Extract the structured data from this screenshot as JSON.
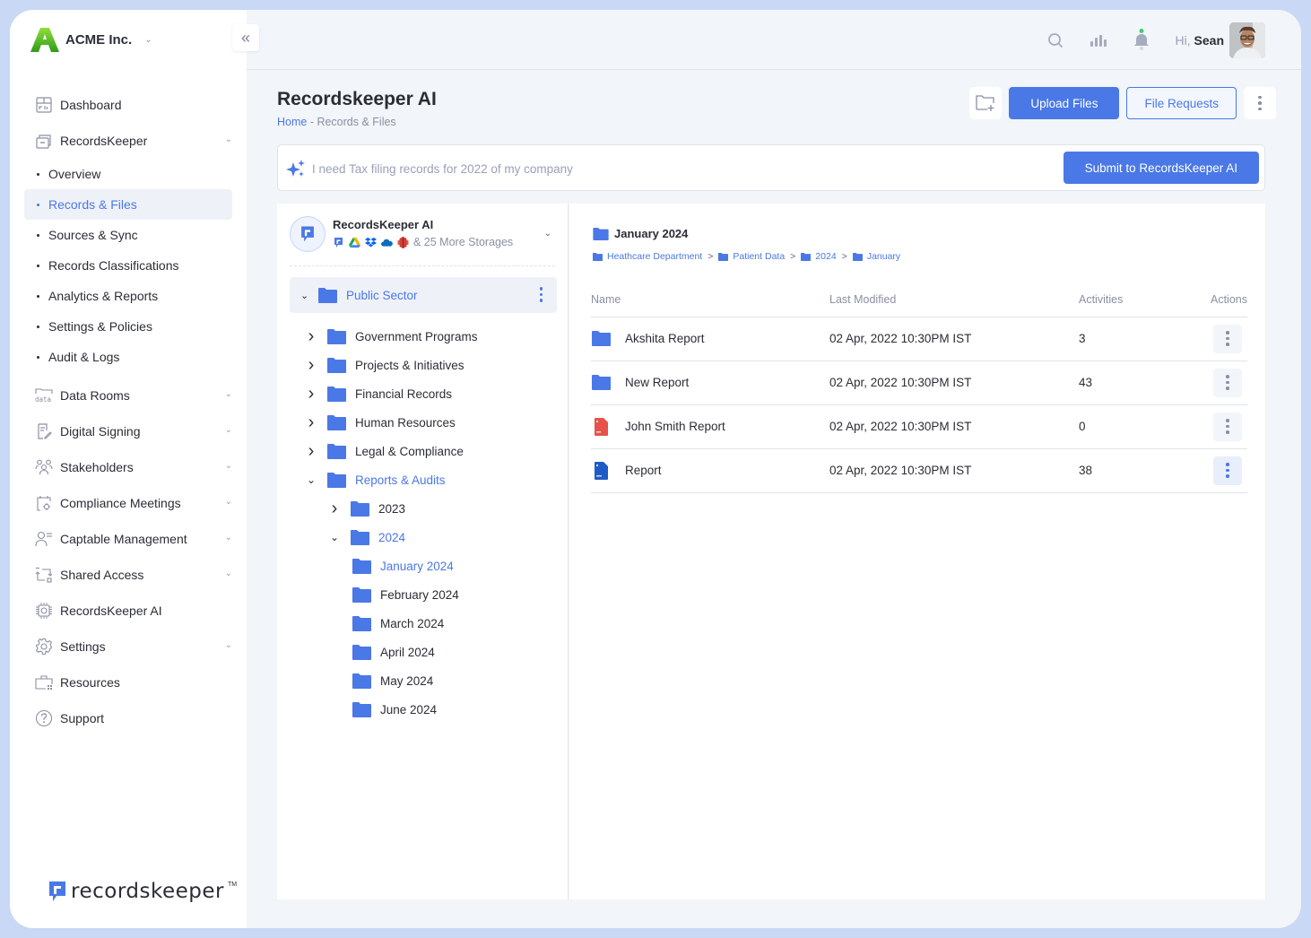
{
  "brand": {
    "company": "ACME Inc."
  },
  "sidebar": {
    "items": [
      {
        "label": "Dashboard",
        "icon": "dashboard-icon",
        "expandable": false
      },
      {
        "label": "RecordsKeeper",
        "icon": "archive-box-icon",
        "expandable": true,
        "children": [
          {
            "label": "Overview",
            "active": false
          },
          {
            "label": "Records & Files",
            "active": true
          },
          {
            "label": "Sources & Sync",
            "active": false
          },
          {
            "label": "Records Classifications",
            "active": false
          },
          {
            "label": "Analytics & Reports",
            "active": false
          },
          {
            "label": "Settings & Policies",
            "active": false
          },
          {
            "label": "Audit & Logs",
            "active": false
          }
        ]
      },
      {
        "label": "Data Rooms",
        "icon": "data-folder-icon",
        "expandable": true
      },
      {
        "label": "Digital Signing",
        "icon": "document-sign-icon",
        "expandable": true
      },
      {
        "label": "Stakeholders",
        "icon": "users-group-icon",
        "expandable": true
      },
      {
        "label": "Compliance Meetings",
        "icon": "calendar-gear-icon",
        "expandable": true
      },
      {
        "label": "Captable Management",
        "icon": "user-list-icon",
        "expandable": true
      },
      {
        "label": "Shared Access",
        "icon": "share-transfer-icon",
        "expandable": true
      },
      {
        "label": "RecordsKeeper AI",
        "icon": "ai-chip-icon",
        "expandable": false
      },
      {
        "label": "Settings",
        "icon": "gear-icon",
        "expandable": true
      },
      {
        "label": "Resources",
        "icon": "briefcase-icon",
        "expandable": false
      },
      {
        "label": "Support",
        "icon": "help-circle-icon",
        "expandable": false
      }
    ],
    "footer_logo": {
      "word": "recordskeeper",
      "tm": "TM"
    }
  },
  "topbar": {
    "greeting_prefix": "Hi,",
    "user_name": "Sean",
    "notification_dot_color": "#3ecf74"
  },
  "page": {
    "title": "Recordskeeper AI",
    "breadcrumb": {
      "home": "Home",
      "separator": " - ",
      "current": "Records & Files"
    },
    "actions": {
      "upload": "Upload Files",
      "requests": "File Requests"
    }
  },
  "ai_prompt": {
    "placeholder": "I need Tax filing records for 2022 of my company",
    "submit": "Submit to RecordsKeeper AI"
  },
  "storage": {
    "name": "RecordsKeeper AI",
    "more": "& 25 More Storages",
    "providers": [
      "recordskeeper",
      "google-drive",
      "dropbox",
      "onedrive",
      "aws-s3"
    ]
  },
  "tree": {
    "root": "Public Sector",
    "nodes": [
      {
        "label": "Government Programs",
        "level": 1,
        "caret": "right",
        "active": false
      },
      {
        "label": "Projects & Initiatives",
        "level": 1,
        "caret": "right",
        "active": false
      },
      {
        "label": "Financial Records",
        "level": 1,
        "caret": "right",
        "active": false
      },
      {
        "label": "Human Resources",
        "level": 1,
        "caret": "right",
        "active": false
      },
      {
        "label": "Legal & Compliance",
        "level": 1,
        "caret": "right",
        "active": false
      },
      {
        "label": "Reports & Audits",
        "level": 1,
        "caret": "down",
        "active": true
      },
      {
        "label": "2023",
        "level": 2,
        "caret": "right",
        "active": false
      },
      {
        "label": "2024",
        "level": 2,
        "caret": "down",
        "active": true
      },
      {
        "label": "January 2024",
        "level": 3,
        "caret": "none",
        "active": true
      },
      {
        "label": "February 2024",
        "level": 3,
        "caret": "none",
        "active": false
      },
      {
        "label": "March 2024",
        "level": 3,
        "caret": "none",
        "active": false
      },
      {
        "label": "April 2024",
        "level": 3,
        "caret": "none",
        "active": false
      },
      {
        "label": "May 2024",
        "level": 3,
        "caret": "none",
        "active": false
      },
      {
        "label": "June 2024",
        "level": 3,
        "caret": "none",
        "active": false
      }
    ]
  },
  "files_panel": {
    "current_folder": "January 2024",
    "path": [
      "Heathcare Department",
      "Patient Data",
      "2024",
      "January"
    ],
    "columns": [
      "Name",
      "Last Modified",
      "Activities",
      "Actions"
    ],
    "rows": [
      {
        "name": "Akshita Report",
        "type": "folder",
        "modified": "02 Apr, 2022 10:30PM IST",
        "activities": "3",
        "highlighted": false
      },
      {
        "name": "New Report",
        "type": "folder",
        "modified": "02 Apr, 2022 10:30PM IST",
        "activities": "43",
        "highlighted": false
      },
      {
        "name": "John Smith Report",
        "type": "pdf",
        "modified": "02 Apr, 2022 10:30PM IST",
        "activities": "0",
        "highlighted": false
      },
      {
        "name": "Report",
        "type": "doc",
        "modified": "02 Apr, 2022 10:30PM IST",
        "activities": "38",
        "highlighted": true
      }
    ]
  },
  "colors": {
    "accent": "#4a78e6",
    "folder": "#4a78e6",
    "pdf": "#e5534b",
    "doc": "#1f5bc6",
    "frame_bg": "#f2f5f9",
    "outer_bg": "#c9d8f5"
  }
}
